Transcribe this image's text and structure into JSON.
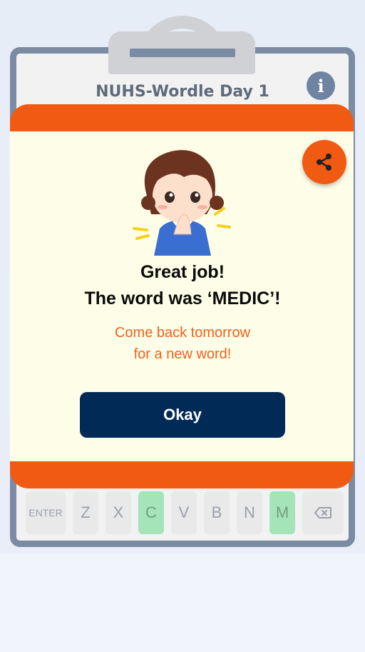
{
  "header": {
    "title": "NUHS-Wordle Day 1",
    "info_icon": "info-icon",
    "info_glyph": "i"
  },
  "modal": {
    "line1": "Great job!",
    "line2": "The word was ‘MEDIC’!",
    "sub1": "Come back tomorrow",
    "sub2": "for a new word!",
    "okay_label": "Okay",
    "share_icon": "share-icon"
  },
  "keyboard": {
    "keys": [
      "ENTER",
      "Z",
      "X",
      "C",
      "V",
      "B",
      "N",
      "M"
    ],
    "backspace_icon": "backspace-icon",
    "highlighted": [
      "C",
      "M"
    ]
  },
  "colors": {
    "accent": "#f15a12",
    "modal_bg": "#fefee8",
    "button_bg": "#012b56",
    "key_hit": "#a5e4b8",
    "frame": "#7b8ba3"
  }
}
